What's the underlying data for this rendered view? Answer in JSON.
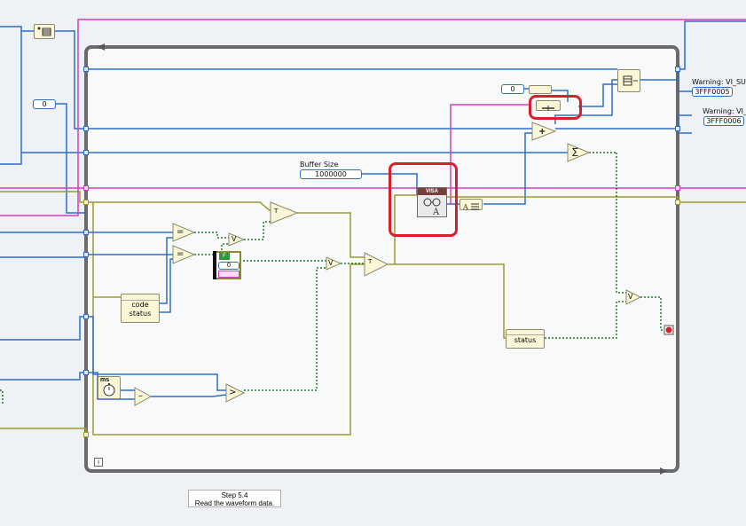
{
  "labels": {
    "buffer_size": "Buffer Size",
    "warning_1": "Warning: VI_SUC",
    "warning_2": "Warning: VI_",
    "code": "code",
    "status_1": "status",
    "status_2": "status",
    "ms": "ms",
    "visa_header": "VISA",
    "true_label": "T",
    "false_label": "F"
  },
  "constants": {
    "zero_left": "0",
    "zero_top": "0",
    "zero_flat": "0",
    "buffer_size": "1000000",
    "hex_1": "3FFF0005",
    "hex_2": "3FFF0006"
  },
  "operators": {
    "equal": "=",
    "equal_2": "=",
    "or": "V",
    "or_2": "V",
    "or_3": "V",
    "subtract": "–",
    "greater": ">",
    "add": "+",
    "sum": "∑",
    "select": "T"
  },
  "note": {
    "line1": "Step 5.4",
    "line2": "Read the waveform data."
  },
  "info_glyph": "i",
  "colors": {
    "int_wire": "#2d6ec9",
    "bool_wire": "#1f7a1f",
    "error_wire": "#9e9a2f",
    "visa_wire": "#d23fc4",
    "loop_border": "#6a6a6a",
    "highlight": "#d6202c"
  }
}
